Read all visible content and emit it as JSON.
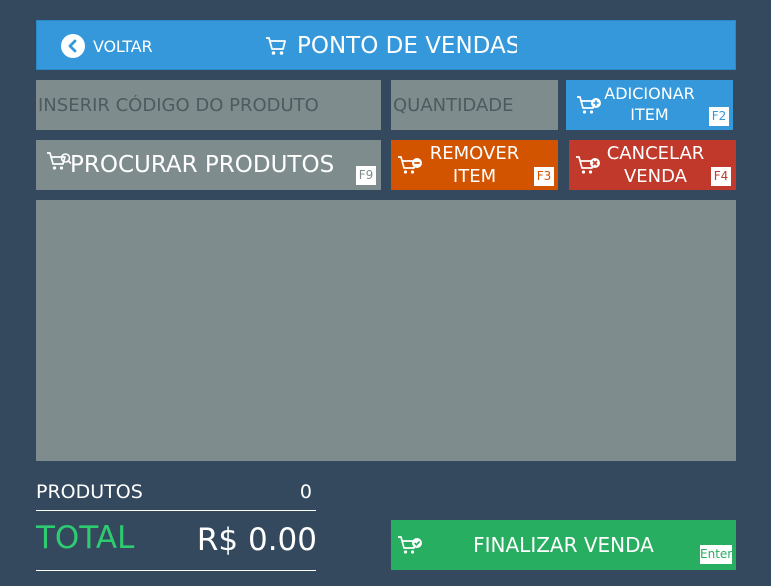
{
  "header": {
    "back_label": "VOLTAR",
    "title": "PONTO DE VENDAS"
  },
  "inputs": {
    "product_code_placeholder": "INSERIR CÓDIGO DO PRODUTO",
    "quantity_placeholder": "QUANTIDADE"
  },
  "buttons": {
    "add_item": {
      "label_line1": "ADICIONAR",
      "label_line2": "ITEM",
      "key": "F2"
    },
    "search_products": {
      "label": "PROCURAR PRODUTOS",
      "key": "F9"
    },
    "remove_item": {
      "label_line1": "REMOVER",
      "label_line2": "ITEM",
      "key": "F3"
    },
    "cancel_sale": {
      "label_line1": "CANCELAR",
      "label_line2": "VENDA",
      "key": "F4"
    },
    "finish_sale": {
      "label": "FINALIZAR VENDA",
      "key": "Enter"
    }
  },
  "summary": {
    "products_label": "PRODUTOS",
    "products_count": "0",
    "total_label": "TOTAL",
    "total_value": "R$ 0.00"
  },
  "colors": {
    "background": "#34495e",
    "header_blue": "#3498db",
    "field_gray": "#7f8c8d",
    "remove_orange": "#d35400",
    "cancel_red": "#c0392b",
    "finish_green": "#27ae60",
    "total_green": "#2ecc71"
  },
  "icons": {
    "back": "chevron-left-icon",
    "title": "cart-icon",
    "add": "cart-plus-icon",
    "search": "cart-search-icon",
    "remove": "cart-minus-icon",
    "cancel": "cart-x-icon",
    "finish": "cart-check-icon"
  }
}
